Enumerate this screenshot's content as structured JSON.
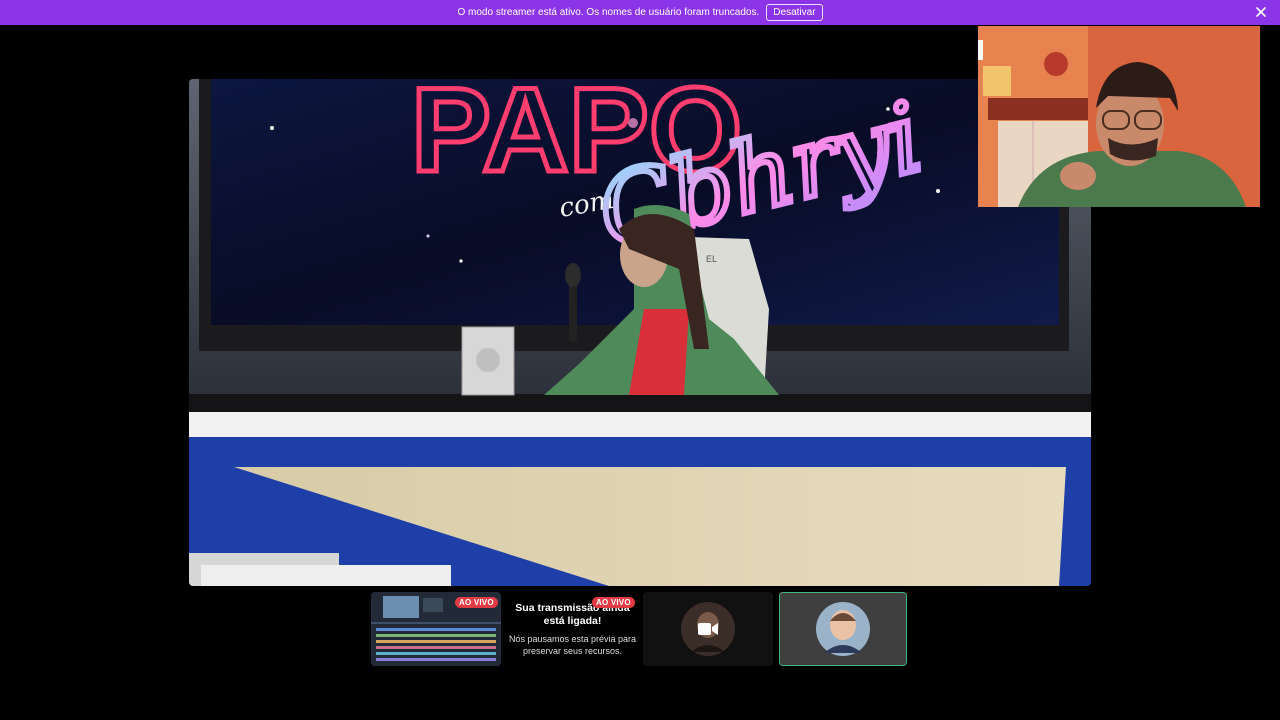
{
  "banner": {
    "message": "O modo streamer está ativo. Os nomes de usuário foram truncados.",
    "button_label": "Desativar",
    "close_icon": "close-icon",
    "color": "#8c35e8"
  },
  "main_stream": {
    "sign_top": "PAPO",
    "sign_com": "com",
    "sign_script": "Cbhryi",
    "chair_text": "EL"
  },
  "tiles": {
    "screen_live_badge": "AO VIVO",
    "notice_live_badge": "AO VIVO",
    "notice_title": "Sua transmissão ainda está ligada!",
    "notice_body": "Nós pausamos esta prévia para preservar seus recursos.",
    "camera_icon": "video-camera-icon"
  },
  "colors": {
    "live_red": "#e23b44",
    "speaking_green": "#43b581"
  }
}
